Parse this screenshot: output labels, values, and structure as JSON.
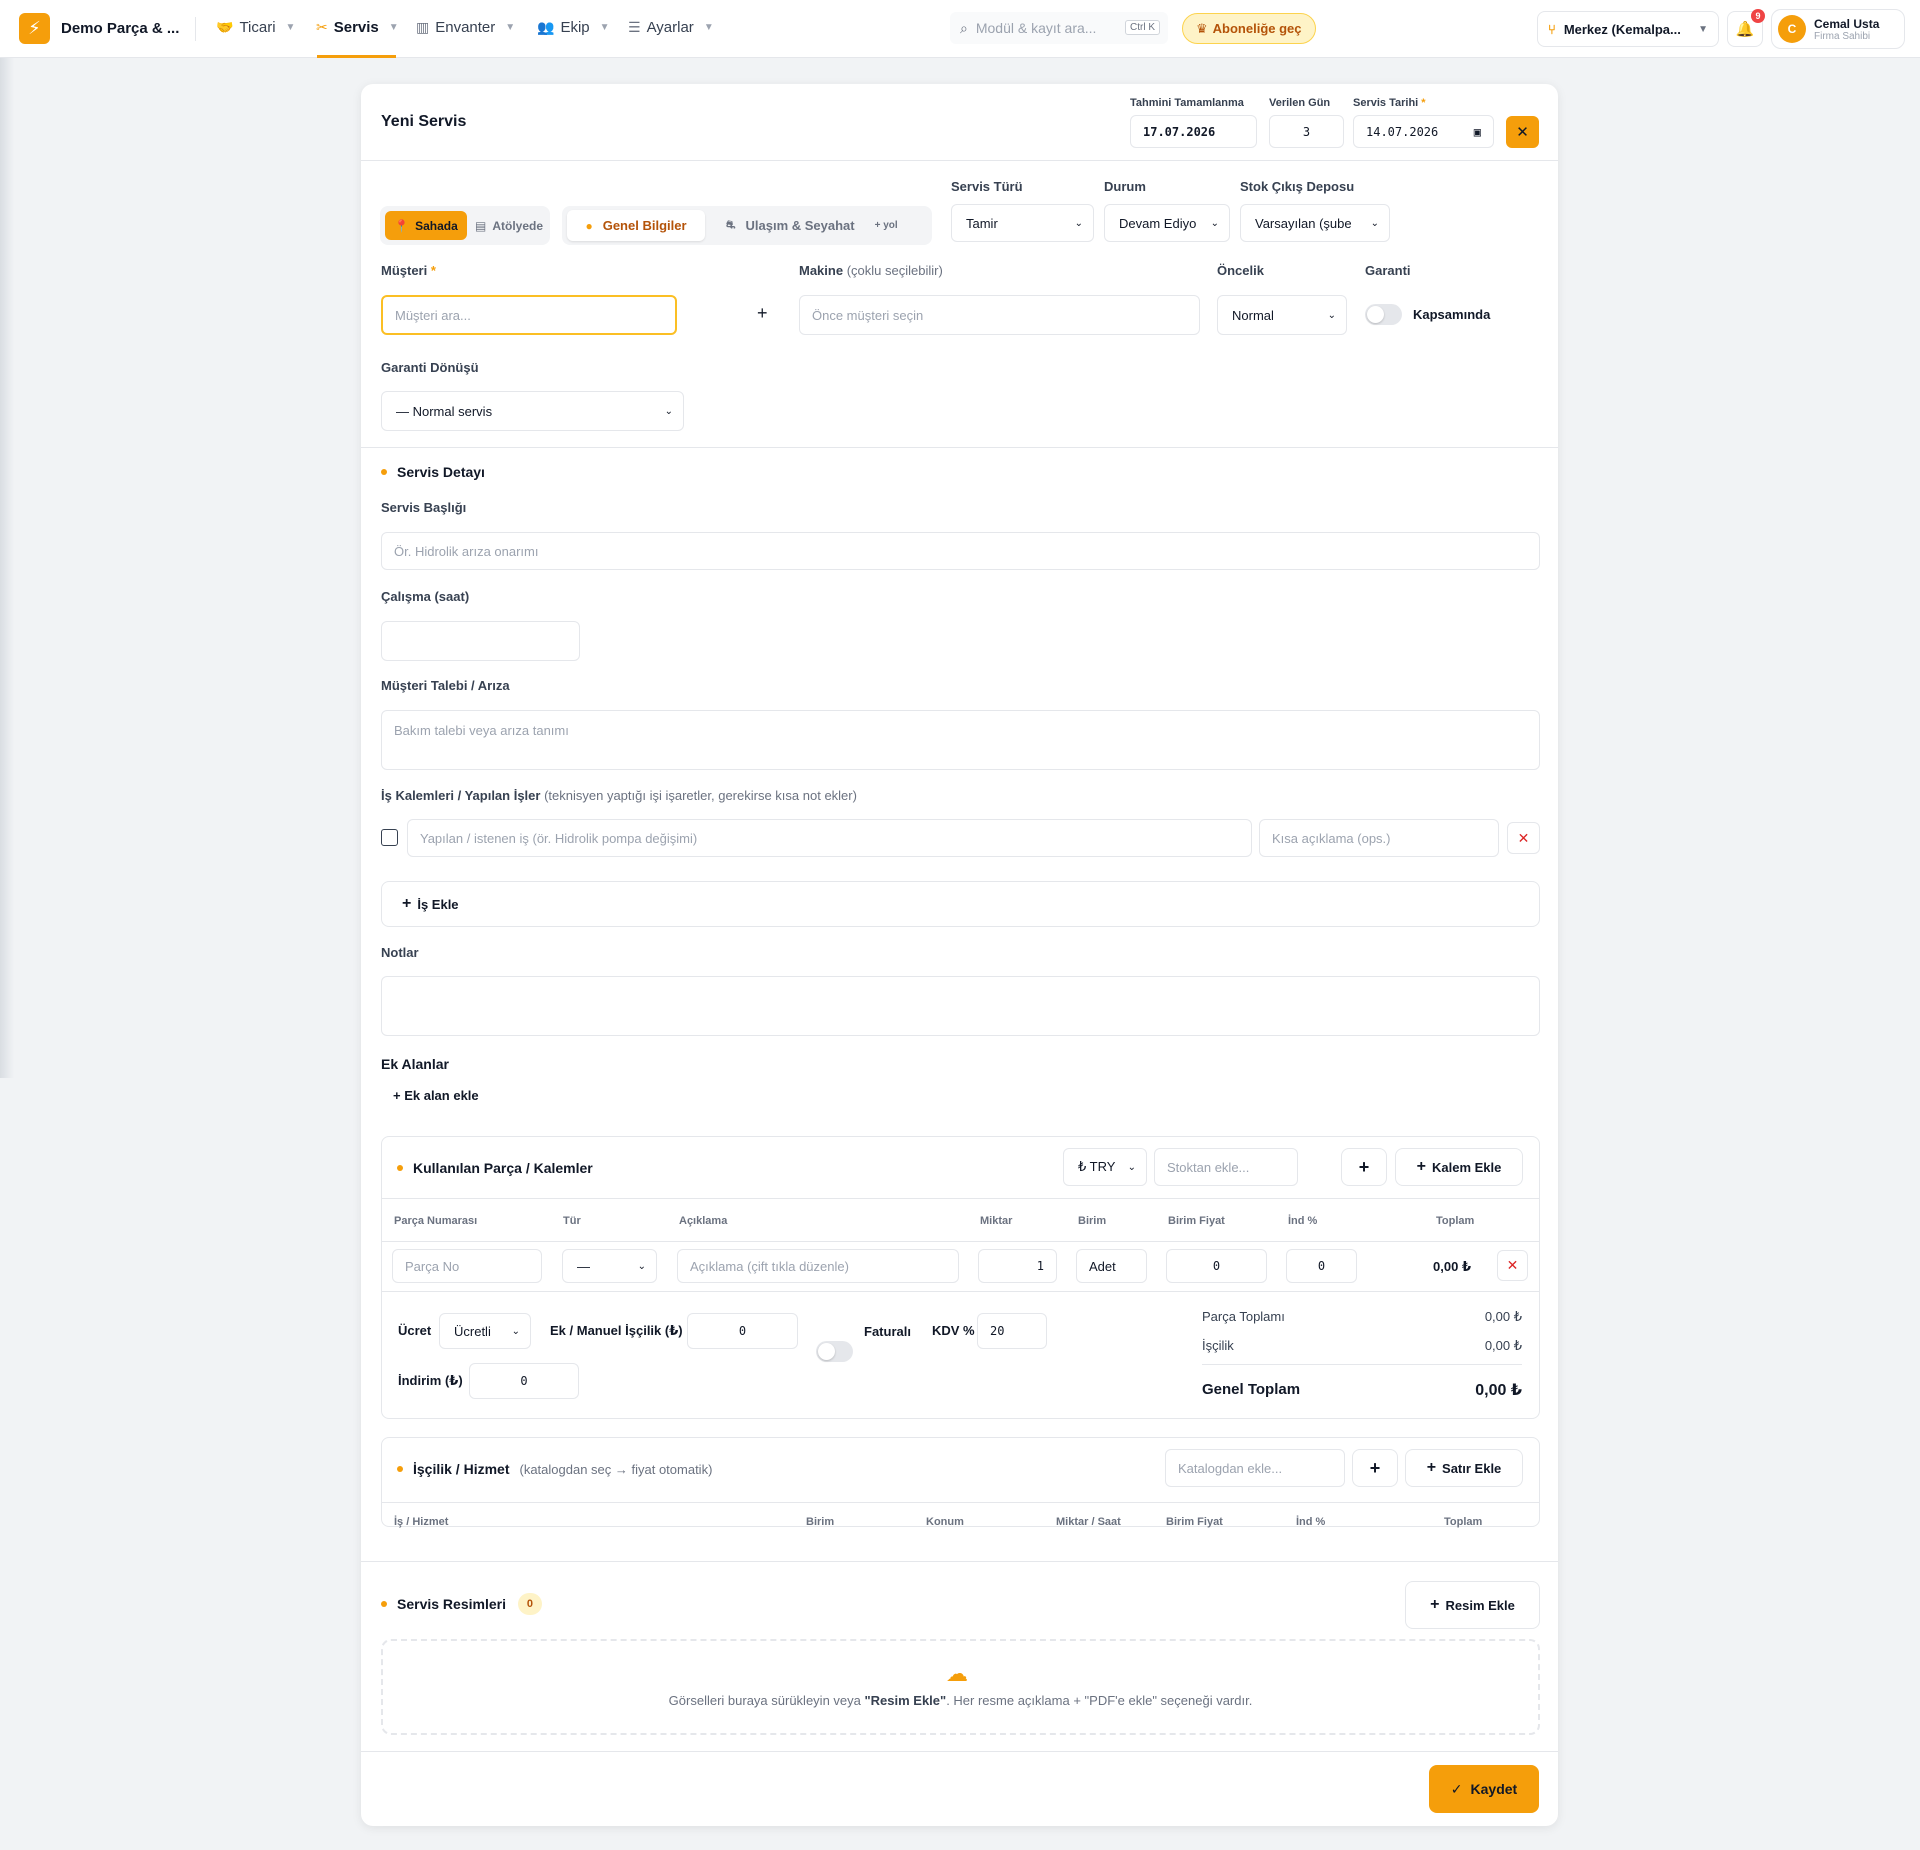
{
  "topbar": {
    "brand": "Demo Parça & ...",
    "nav": [
      {
        "label": "Ticari",
        "icon": "handshake-icon"
      },
      {
        "label": "Servis",
        "icon": "tools-icon"
      },
      {
        "label": "Envanter",
        "icon": "warehouse-icon"
      },
      {
        "label": "Ekip",
        "icon": "team-icon"
      },
      {
        "label": "Ayarlar",
        "icon": "sliders-icon"
      }
    ],
    "search_placeholder": "Modül & kayıt ara...",
    "search_shortcut": "Ctrl K",
    "subscribe_label": "Aboneliğe geç",
    "branch": "Merkez (Kemalpa...",
    "notification_count": "9",
    "user_initial": "C",
    "user_name": "Cemal Usta",
    "user_role": "Firma Sahibi"
  },
  "form": {
    "title": "Yeni Servis",
    "est_completion_label": "Tahmini Tamamlanma",
    "est_completion_value": "17.07.2026",
    "given_days_label": "Verilen Gün",
    "given_days_value": "3",
    "service_date_label": "Servis Tarihi",
    "service_date_value": "14.07.2026",
    "location_onsite": "Sahada",
    "location_workshop": "Atölyede",
    "tab_general": "Genel Bilgiler",
    "tab_travel": "Ulaşım & Seyahat",
    "tab_travel_hint": "+ yol",
    "service_type_label": "Servis Türü",
    "service_type_value": "Tamir",
    "status_label": "Durum",
    "status_value": "Devam Ediyo",
    "stock_depot_label": "Stok Çıkış Deposu",
    "stock_depot_value": "Varsayılan (şube",
    "customer_label": "Müşteri",
    "customer_placeholder": "Müşteri ara...",
    "machine_label": "Makine",
    "machine_hint": "(çoklu seçilebilir)",
    "machine_placeholder": "Önce müşteri seçin",
    "priority_label": "Öncelik",
    "priority_value": "Normal",
    "warranty_label": "Garanti",
    "warranty_toggle_label": "Kapsamında",
    "warranty_return_label": "Garanti Dönüşü",
    "warranty_return_value": "— Normal servis"
  },
  "detail": {
    "section_title": "Servis Detayı",
    "service_title_label": "Servis Başlığı",
    "service_title_placeholder": "Ör. Hidrolik arıza onarımı",
    "work_hours_label": "Çalışma (saat)",
    "request_label": "Müşteri Talebi / Arıza",
    "request_placeholder": "Bakım talebi veya arıza tanımı",
    "tasks_label": "İş Kalemleri / Yapılan İşler",
    "tasks_hint": "(teknisyen yaptığı işi işaretler, gerekirse kısa not ekler)",
    "task_placeholder": "Yapılan / istenen iş (ör. Hidrolik pompa değişimi)",
    "task_note_placeholder": "Kısa açıklama (ops.)",
    "add_task_label": "İş Ekle",
    "notes_label": "Notlar",
    "extra_fields_label": "Ek Alanlar",
    "add_extra_field_label": "+ Ek alan ekle"
  },
  "parts": {
    "section_title": "Kullanılan Parça / Kalemler",
    "currency": "₺ TRY",
    "stock_placeholder": "Stoktan ekle...",
    "add_item_label": "Kalem Ekle",
    "columns": [
      "Parça Numarası",
      "Tür",
      "Açıklama",
      "Miktar",
      "Birim",
      "Birim Fiyat",
      "İnd %",
      "Toplam"
    ],
    "row": {
      "part_no_placeholder": "Parça No",
      "type": "—",
      "desc_placeholder": "Açıklama (çift tıkla düzenle)",
      "qty": "1",
      "unit": "Adet",
      "unit_price": "0",
      "discount": "0",
      "total": "0,00 ₺"
    },
    "fee_label": "Ücret",
    "fee_value": "Ücretli",
    "manual_labor_label": "Ek / Manuel İşçilik (₺)",
    "manual_labor_value": "0",
    "invoiced_label": "Faturalı",
    "vat_label": "KDV %",
    "vat_value": "20",
    "discount_label": "İndirim (₺)",
    "discount_value": "0",
    "parts_total_label": "Parça Toplamı",
    "parts_total_value": "0,00 ₺",
    "labor_label": "İşçilik",
    "labor_value": "0,00 ₺",
    "grand_total_label": "Genel Toplam",
    "grand_total_value": "0,00 ₺"
  },
  "labor": {
    "section_title": "İşçilik / Hizmet",
    "hint": "(katalogdan seç → fiyat otomatik)",
    "catalog_placeholder": "Katalogdan ekle...",
    "add_row_label": "Satır Ekle",
    "columns": [
      "İş / Hizmet",
      "Birim",
      "Konum",
      "Miktar / Saat",
      "Birim Fiyat",
      "İnd %",
      "Toplam"
    ]
  },
  "images": {
    "section_title": "Servis Resimleri",
    "count": "0",
    "add_image_label": "Resim Ekle",
    "drop_text_before": "Görselleri buraya sürükleyin veya ",
    "drop_text_strong": "\"Resim Ekle\"",
    "drop_text_after": ". Her resme açıklama + \"PDF'e ekle\" seçeneği vardır."
  },
  "footer": {
    "save_label": "Kaydet"
  },
  "colors": {
    "accent": "#f59e0b",
    "danger": "#dc2626"
  }
}
